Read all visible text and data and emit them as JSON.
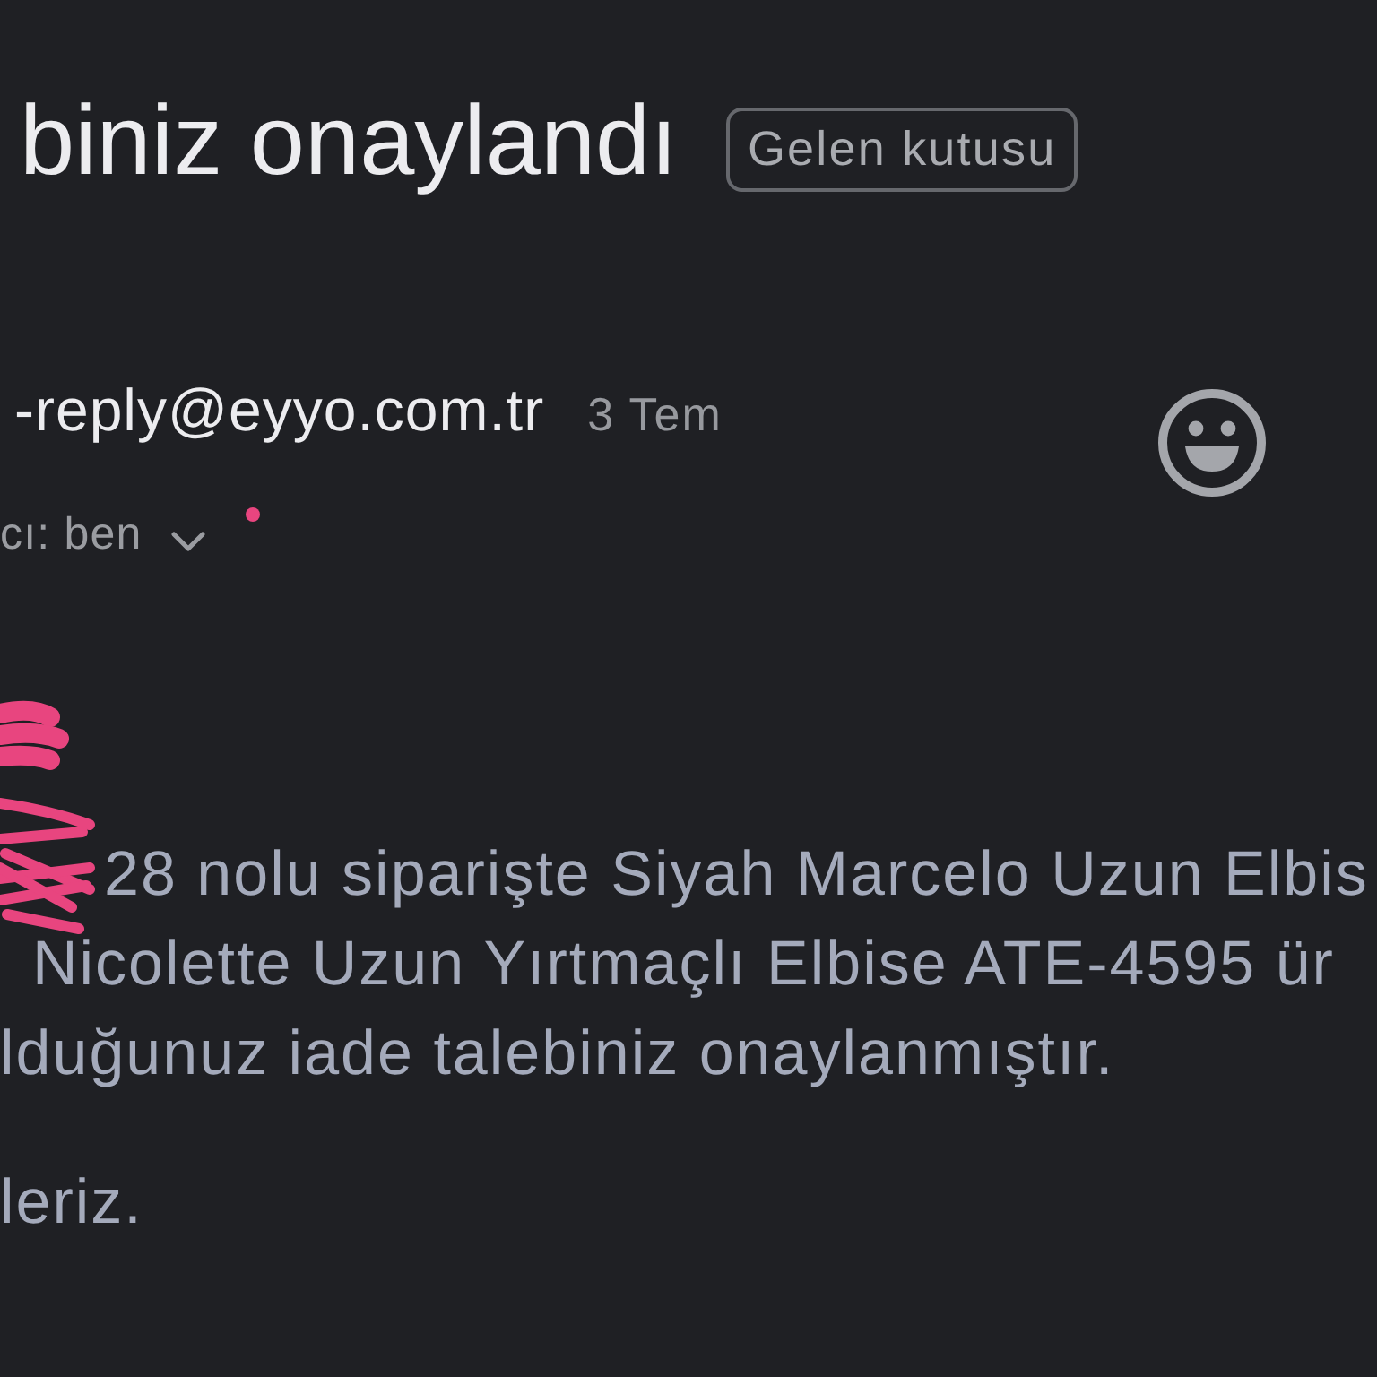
{
  "header": {
    "subject": "biniz onaylandı",
    "label": "Gelen kutusu"
  },
  "message": {
    "sender": "-reply@eyyo.com.tr",
    "date": "3 Tem",
    "recipient": "cı: ben",
    "details_expanded": false
  },
  "body": {
    "paragraphs": [
      {
        "lines": [
          "28 nolu siparişte Siyah Marcelo Uzun Elbis",
          "Nicolette Uzun Yırtmaçlı Elbise ATE-4595 ür",
          "lduğunuz iade talebiniz onaylanmıştır."
        ]
      },
      {
        "lines": [
          "leriz."
        ]
      }
    ]
  }
}
